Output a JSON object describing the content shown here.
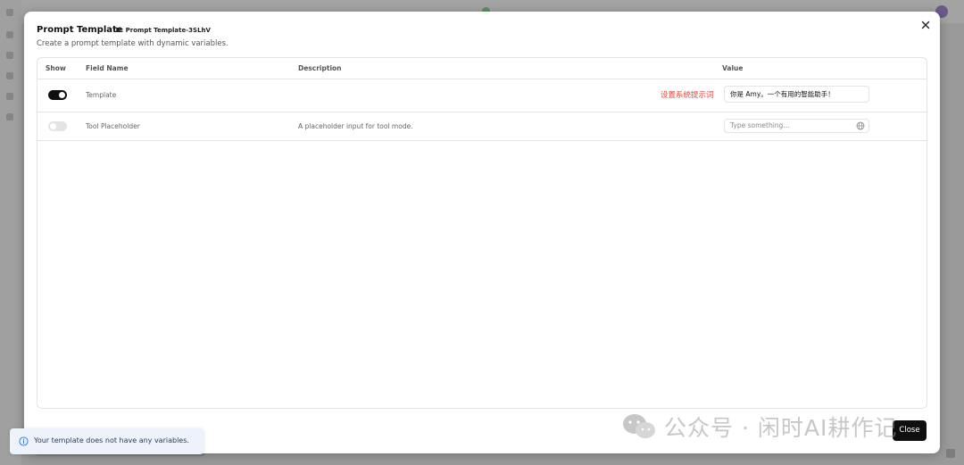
{
  "modal": {
    "title": "Prompt Template",
    "id_label": "ID: Prompt Template-3SLhV",
    "subtitle": "Create a prompt template with dynamic variables.",
    "close_label": "Close"
  },
  "table": {
    "headers": {
      "show": "Show",
      "field_name": "Field Name",
      "description": "Description",
      "value": "Value"
    },
    "rows": [
      {
        "show": true,
        "field_name": "Template",
        "description": "",
        "annotation": "设置系统提示词",
        "value": "你是 Amy。一个有用的智能助手！"
      },
      {
        "show": false,
        "field_name": "Tool Placeholder",
        "description": "A placeholder input for tool mode.",
        "placeholder": "Type something..."
      }
    ]
  },
  "toast": {
    "message": "Your template does not have any variables."
  },
  "watermark": {
    "text": "公众号 · 闲时AI耕作记"
  },
  "colors": {
    "accent": "#0f0f0f",
    "annotation": "#e0483f",
    "toast_bg": "#eef3fb"
  }
}
